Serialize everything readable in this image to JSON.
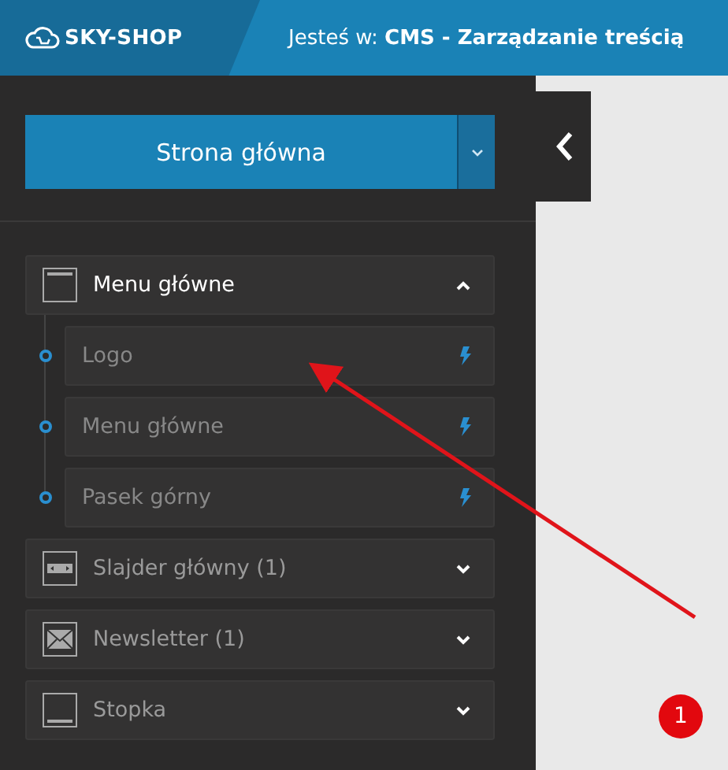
{
  "header": {
    "logo": "SKY-SHOP",
    "location": "Jesteś w: **CMS - Zarządzanie treścią**"
  },
  "page_select": {
    "value": "Strona główna"
  },
  "sections": [
    {
      "label": "Menu główne",
      "kind": "window",
      "expanded": true,
      "children": [
        {
          "label": "Logo"
        },
        {
          "label": "Menu główne"
        },
        {
          "label": "Pasek górny"
        }
      ]
    },
    {
      "label": "Slajder główny (1)",
      "kind": "slider",
      "expanded": false
    },
    {
      "label": "Newsletter (1)",
      "kind": "envelope",
      "expanded": false
    },
    {
      "label": "Stopka",
      "kind": "footer",
      "expanded": false
    }
  ],
  "annotation": {
    "badge": "1"
  }
}
